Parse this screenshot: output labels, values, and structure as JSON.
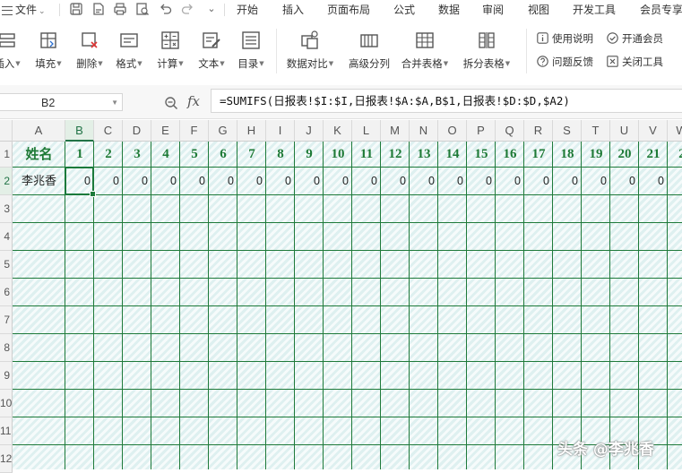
{
  "menu": {
    "file_label": "文件",
    "tabs": [
      "开始",
      "插入",
      "页面布局",
      "公式",
      "数据",
      "审阅",
      "视图",
      "开发工具",
      "会员专享"
    ]
  },
  "ribbon": {
    "buttons": [
      {
        "label": "插入",
        "icon": "insert-rows-icon",
        "dropdown": true
      },
      {
        "label": "填充",
        "icon": "fill-icon",
        "dropdown": true
      },
      {
        "label": "删除",
        "icon": "delete-icon",
        "dropdown": true
      },
      {
        "label": "格式",
        "icon": "format-icon",
        "dropdown": true
      },
      {
        "label": "计算",
        "icon": "calculator-icon",
        "dropdown": true
      },
      {
        "label": "文本",
        "icon": "text-edit-icon",
        "dropdown": true
      },
      {
        "label": "目录",
        "icon": "table-of-contents-icon",
        "dropdown": true
      },
      {
        "label": "数据对比",
        "icon": "data-compare-icon",
        "dropdown": true
      },
      {
        "label": "高级分列",
        "icon": "split-columns-icon",
        "dropdown": false
      },
      {
        "label": "合并表格",
        "icon": "merge-tables-icon",
        "dropdown": true
      },
      {
        "label": "拆分表格",
        "icon": "split-table-icon",
        "dropdown": true
      }
    ],
    "side_items": [
      {
        "label": "使用说明",
        "icon": "info-icon"
      },
      {
        "label": "开通会员",
        "icon": "check-circle-icon"
      },
      {
        "label": "问题反馈",
        "icon": "question-icon"
      },
      {
        "label": "关闭工具",
        "icon": "close-box-icon"
      }
    ]
  },
  "formula_bar": {
    "cell_ref": "B2",
    "fx": "fx",
    "formula": "=SUMIFS(日报表!$I:$I,日报表!$A:$A,B$1,日报表!$D:$D,$A2)"
  },
  "sheet": {
    "columns": [
      "A",
      "B",
      "C",
      "D",
      "E",
      "F",
      "G",
      "H",
      "I",
      "J",
      "K",
      "L",
      "M",
      "N",
      "O",
      "P",
      "Q",
      "R",
      "S",
      "T",
      "U",
      "V",
      "W"
    ],
    "selected_column": "B",
    "rows": [
      "1",
      "2",
      "3",
      "4",
      "5",
      "6",
      "7",
      "8",
      "9",
      "10",
      "11",
      "12"
    ],
    "selected_row": "2",
    "header_row": [
      "姓名",
      "1",
      "2",
      "3",
      "4",
      "5",
      "6",
      "7",
      "8",
      "9",
      "10",
      "11",
      "12",
      "13",
      "14",
      "15",
      "16",
      "17",
      "18",
      "19",
      "20",
      "21",
      "2"
    ],
    "data_row": [
      "李兆香",
      "0",
      "0",
      "0",
      "0",
      "0",
      "0",
      "0",
      "0",
      "0",
      "0",
      "0",
      "0",
      "0",
      "0",
      "0",
      "0",
      "0",
      "0",
      "0",
      "0",
      "0",
      ""
    ]
  },
  "colors": {
    "grid_line": "#1f7a3a",
    "header_text": "#1e7a36",
    "cell_fill": "#eaf6f6",
    "selection": "#1b7a3b"
  },
  "watermark": "头条 @李兆香"
}
